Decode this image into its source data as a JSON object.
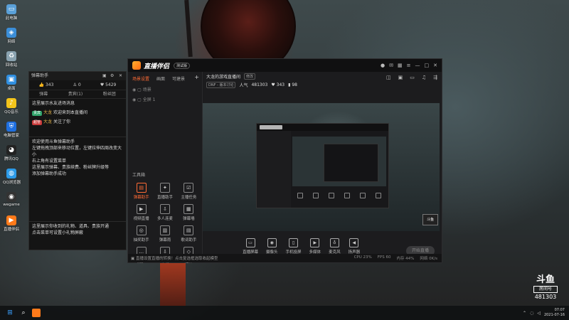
{
  "desktop": {
    "icons": [
      {
        "label": "此电脑",
        "icon": "computer-icon",
        "color": "#5aa0d8",
        "glyph": "▭"
      },
      {
        "label": "网络",
        "icon": "network-icon",
        "color": "#3b8ed8",
        "glyph": "◈"
      },
      {
        "label": "回收站",
        "icon": "recycle-bin-icon",
        "color": "#8aa3b0",
        "glyph": "♻"
      },
      {
        "label": "桌面",
        "icon": "folder-icon",
        "color": "#2f8fe0",
        "glyph": "▣"
      },
      {
        "label": "QQ音乐",
        "icon": "qq-music-icon",
        "color": "#f2c41b",
        "glyph": "♪"
      },
      {
        "label": "电脑管家",
        "icon": "pc-manager-icon",
        "color": "#1e6fe0",
        "glyph": "⛨"
      },
      {
        "label": "腾讯QQ",
        "icon": "qq-icon",
        "color": "#222",
        "glyph": "◕"
      },
      {
        "label": "QQ浏览器",
        "icon": "qq-browser-icon",
        "color": "#2c9be8",
        "glyph": "◍"
      },
      {
        "label": "wegame",
        "icon": "wegame-icon",
        "color": "#333",
        "glyph": "◉"
      },
      {
        "label": "直播伴侣",
        "icon": "live-companion-icon",
        "color": "#ff7a1a",
        "glyph": "▶"
      }
    ]
  },
  "danmu": {
    "title": "弹幕助手",
    "stats": {
      "likes": "343",
      "fans": "0",
      "gifts": "5429"
    },
    "tabs": [
      "弹幕",
      "贵宾(1)",
      "粉丝团"
    ],
    "messages": [
      {
        "text": "这里展示水友进场消息"
      },
      {
        "tag": "贵宾",
        "tag_color": "#2fa36b",
        "name": "大龙",
        "text": "欢迎来到本直播间"
      },
      {
        "tag": "超管",
        "tag_color": "#c93a3a",
        "name": "大龙",
        "text": "关注了你"
      }
    ],
    "intro_lines": [
      "欢迎使用斗鱼弹幕助手",
      "左键拖拽顶部来移动位置，左键拉伸四周改变大小",
      "右上角有设置菜单",
      "这里展示弹幕、贵族续费、粉丝牌升级等",
      "添加弹幕助手成功"
    ],
    "gift_lines": [
      "这里展示你收到的礼物、道具、贵族开通",
      "点击菜单可设置小礼物屏蔽"
    ]
  },
  "app": {
    "name": "直播伴侣",
    "version": "测试版",
    "tabs": [
      "场景设置",
      "画面",
      "可建景"
    ],
    "scene_label": "场景",
    "source_label": "全屏 1",
    "tools_header": "工具箱",
    "tools": [
      {
        "label": "弹幕助手",
        "icon": "danmu-icon",
        "glyph": "▤",
        "hot": true
      },
      {
        "label": "直播助手",
        "icon": "assistant-icon",
        "glyph": "✦",
        "hot": false
      },
      {
        "label": "主播任务",
        "icon": "task-icon",
        "glyph": "☑",
        "hot": false
      },
      {
        "label": "视频直播",
        "icon": "video-icon",
        "glyph": "▶",
        "hot": false
      },
      {
        "label": "多人连麦",
        "icon": "multi-mic-icon",
        "glyph": "⇩",
        "hot": false
      },
      {
        "label": "弹幕墙",
        "icon": "danmu-wall-icon",
        "glyph": "▦",
        "hot": false
      },
      {
        "label": "抽奖助手",
        "icon": "lottery-icon",
        "glyph": "◎",
        "hot": false
      },
      {
        "label": "弹幕雨",
        "icon": "danmu-rain-icon",
        "glyph": "▥",
        "hot": false
      },
      {
        "label": "歌词助手",
        "icon": "lyrics-icon",
        "glyph": "▤",
        "hot": false
      },
      {
        "label": "更多",
        "icon": "more-icon",
        "glyph": "…",
        "hot": false
      },
      {
        "label": "下载",
        "icon": "download-icon",
        "glyph": "⇩",
        "hot": false
      },
      {
        "label": "插件",
        "icon": "plugin-icon",
        "glyph": "◇",
        "hot": false
      }
    ],
    "room_title": "大龙的游戏直播间",
    "room_chip": "修改",
    "room_category": "DNF - 版本讨论",
    "room_stat_label": "人气",
    "room_viewers": "481303",
    "room_likes": "343",
    "room_hot": "98",
    "nested_title": "直播伴侣",
    "bottom_tools": [
      {
        "label": "直播屏幕",
        "icon": "screen-icon",
        "glyph": "▭"
      },
      {
        "label": "摄像头",
        "icon": "camera-icon",
        "glyph": "◉"
      },
      {
        "label": "手机投屏",
        "icon": "phone-cast-icon",
        "glyph": "▯"
      },
      {
        "label": "多媒体",
        "icon": "media-icon",
        "glyph": "▶"
      },
      {
        "label": "麦克风",
        "icon": "mic-icon",
        "glyph": "♁"
      },
      {
        "label": "扬声器",
        "icon": "speaker-icon",
        "glyph": "◀"
      }
    ],
    "start_button": "开始直播",
    "status_text": "直播设置直播的转换！点击复选框选取收起模型",
    "status_metrics": [
      "CPU 23%",
      "FPS 60",
      "内存 44%",
      "网络 0K/s"
    ],
    "douyu_small": "斗鱼"
  },
  "watermark": {
    "brand": "斗鱼",
    "room_label": "房间号",
    "room_id": "481303"
  },
  "taskbar": {
    "time": "07:07",
    "date": "2021-07-16"
  }
}
